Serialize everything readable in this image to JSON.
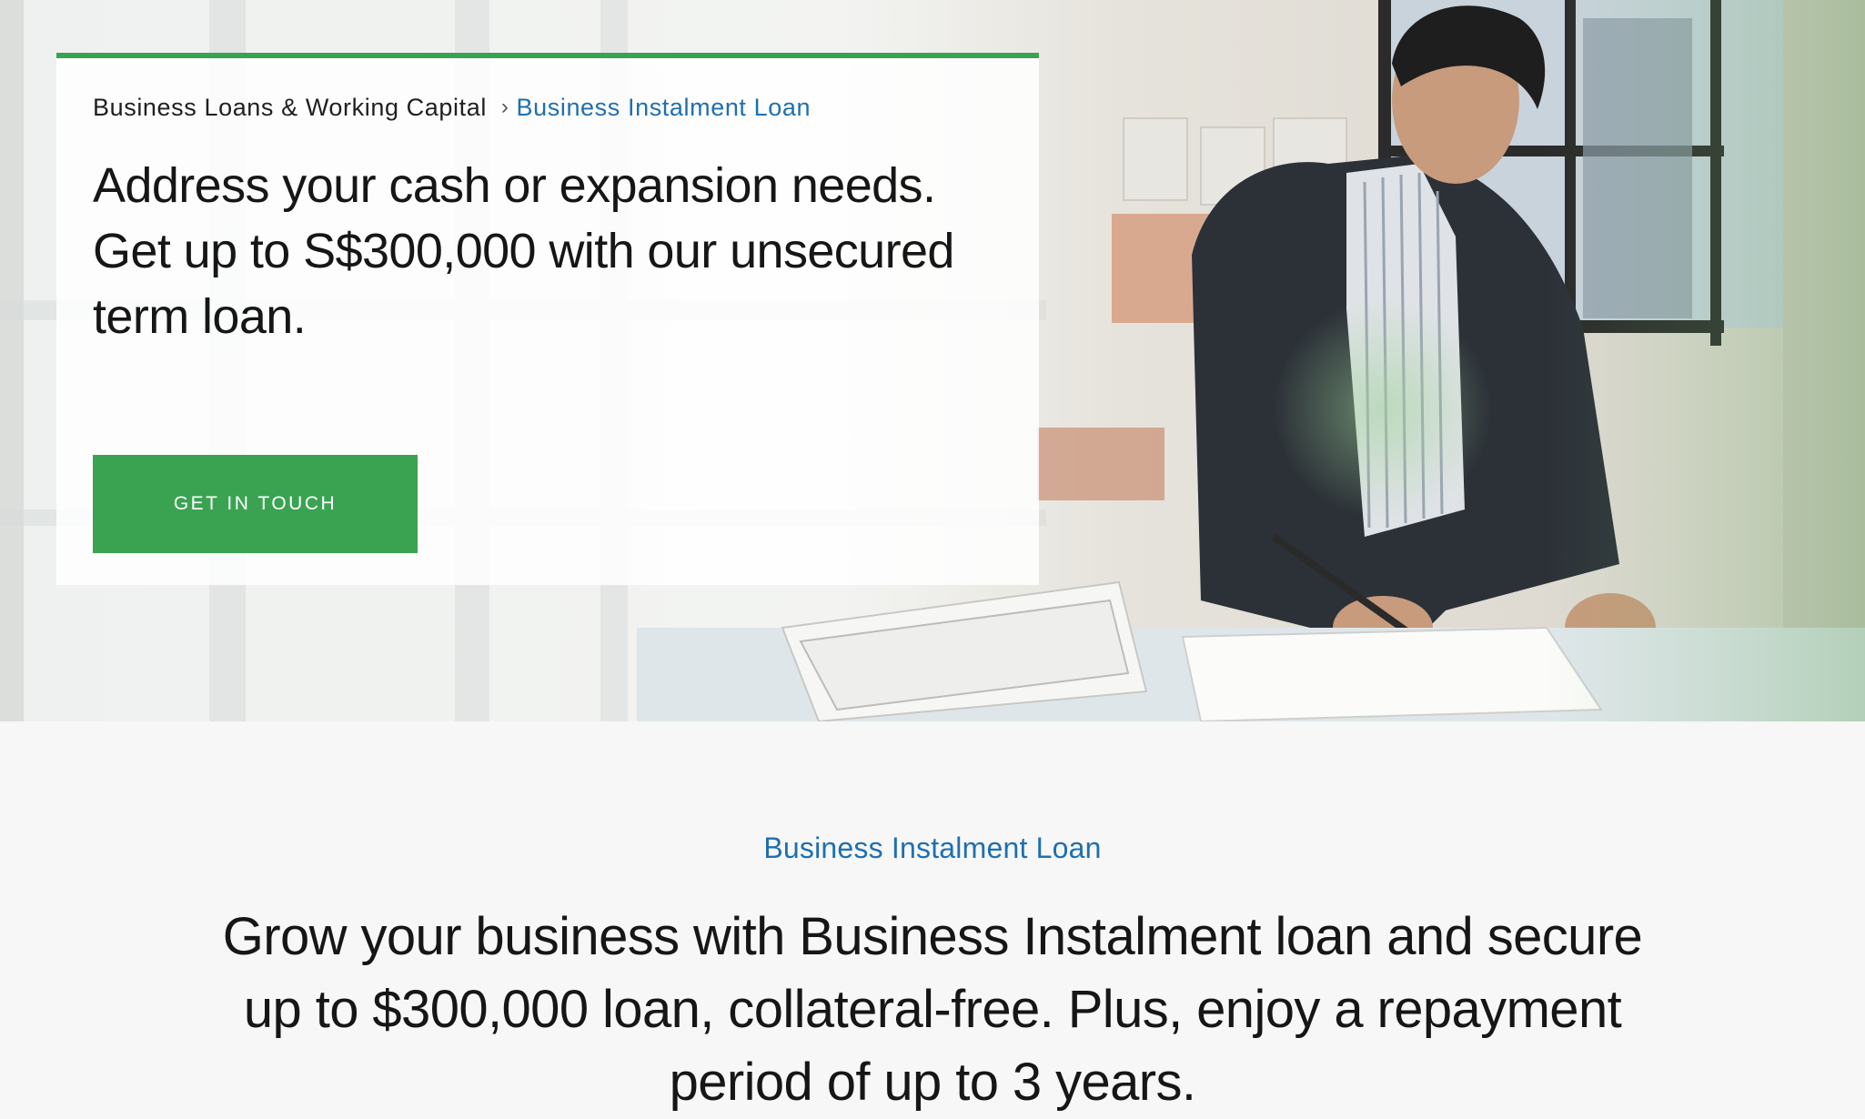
{
  "hero": {
    "breadcrumb": {
      "parent": "Business Loans & Working Capital",
      "separator": "›",
      "current": "Business Instalment Loan"
    },
    "title": "Address your cash or expansion needs. Get up to S$300,000 with our unsecured term loan.",
    "cta_label": "GET IN TOUCH",
    "image": "photo-man-writing-at-desk-with-documents"
  },
  "intro": {
    "label": "Business Instalment Loan",
    "body": "Grow your business with Business Instalment loan and secure up to $300,000 loan, collateral-free. Plus, enjoy a repayment period of up to 3 years."
  },
  "colors": {
    "accent_green": "#3aa352",
    "link_blue": "#1f6fb0",
    "text_dark": "#161616",
    "section_bg": "#f7f7f7"
  }
}
